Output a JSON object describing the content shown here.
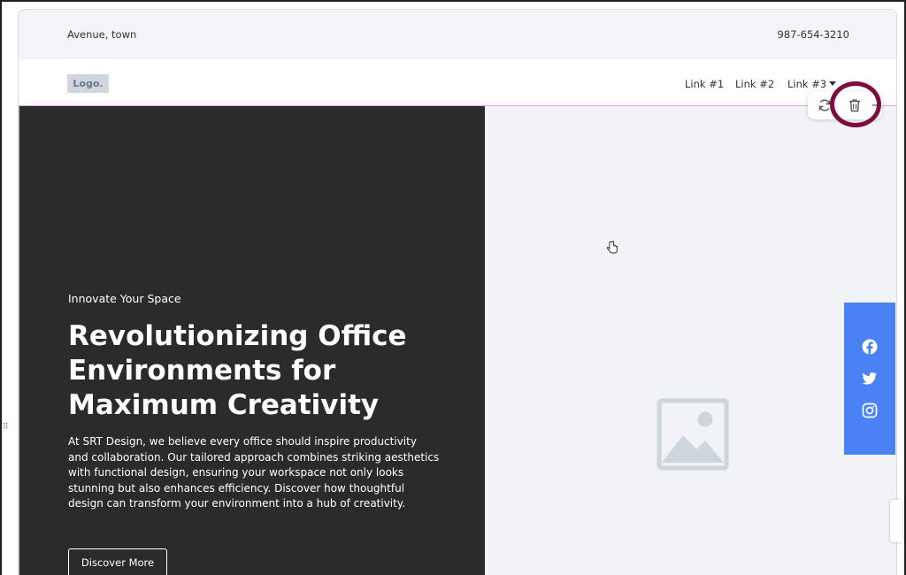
{
  "topbar": {
    "address": "Avenue, town",
    "phone": "987-654-3210"
  },
  "navbar": {
    "logo": "Logo.",
    "links": [
      "Link #1",
      "Link #2",
      "Link #3"
    ]
  },
  "hero": {
    "eyebrow": "Innovate Your Space",
    "headline": "Revolutionizing Office Environments for Maximum Creativity",
    "body": "At SRT Design, we believe every office should inspire productivity and collaboration. Our tailored approach combines striking aesthetics with functional design, ensuring your workspace not only looks stunning but also enhances efficiency. Discover how thoughtful design can transform your environment into a hub of creativity.",
    "cta_label": "Discover More"
  },
  "toolbar": {
    "icons": [
      "rotate-icon",
      "trash-icon"
    ]
  },
  "social": {
    "icons": [
      "facebook-icon",
      "twitter-icon",
      "instagram-icon"
    ]
  },
  "colors": {
    "hero_dark": "#2b2b2b",
    "social_blue": "#4a82f5",
    "highlight_ring": "#7e0d3f",
    "selection_outline": "#e59ce9"
  }
}
